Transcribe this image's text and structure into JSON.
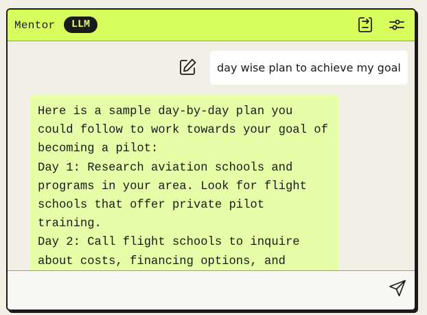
{
  "header": {
    "title": "Mentor",
    "badge": "LLM",
    "icons": [
      "export-icon",
      "settings-sliders-icon"
    ],
    "accent_color": "#d8fe5e"
  },
  "conversation": {
    "user_message": "day wise plan to achieve my goal",
    "assistant_message": "Here is a sample day-by-day plan you could follow to work towards your goal of becoming a pilot:\nDay 1: Research aviation schools and programs in your area. Look for flight schools that offer private pilot training.\nDay 2: Call flight schools to inquire about costs, financing options, and"
  },
  "composer": {
    "value": "",
    "placeholder": "",
    "send_icon": "send-icon"
  }
}
